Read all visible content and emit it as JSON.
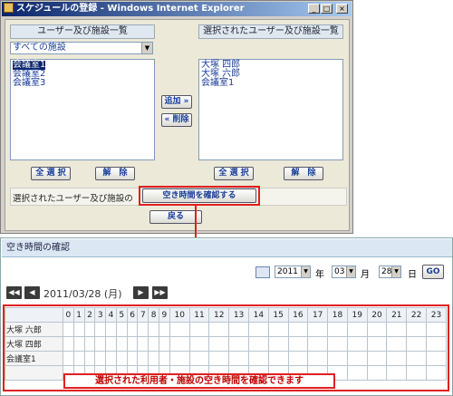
{
  "window": {
    "title": "スケジュールの登録 - Windows Internet Explorer",
    "minimize": "_",
    "maximize": "□",
    "close": "×"
  },
  "left_panel": {
    "header": "ユーザー及び施設一覧",
    "filter_value": "すべての施設",
    "items": [
      "会議室1",
      "会議室2",
      "会議室3"
    ],
    "select_all": "全 選 択",
    "deselect": "解　除"
  },
  "middle": {
    "add": "追加 »",
    "remove": "« 削除"
  },
  "right_panel": {
    "header": "選択されたユーザー及び施設一覧",
    "items": [
      "大塚 四郎",
      "大塚 六郎",
      "会議室1"
    ],
    "select_all": "全 選 択",
    "deselect": "解　除"
  },
  "footer": {
    "label": "選択されたユーザー及び施設の",
    "check_button": "空き時間を確認する",
    "back_button": "戻る"
  },
  "availability": {
    "header": "空き時間の確認",
    "year": "2011",
    "year_suffix": "年",
    "month": "03",
    "month_suffix": "月",
    "day": "28",
    "day_suffix": "日",
    "go": "GO",
    "nav_first": "◀◀",
    "nav_prev": "◀",
    "date_label": "2011/03/28 (月)",
    "nav_next": "▶",
    "nav_last": "▶▶",
    "hours": [
      "0",
      "1",
      "2",
      "3",
      "4",
      "5",
      "6",
      "7",
      "8",
      "9",
      "10",
      "11",
      "12",
      "13",
      "14",
      "15",
      "16",
      "17",
      "18",
      "19",
      "20",
      "21",
      "22",
      "23"
    ],
    "rows": [
      "大塚 六郎",
      "大塚 四郎",
      "会議室1"
    ]
  },
  "callout": {
    "text": "選択された利用者・施設の空き時間を確認できます"
  },
  "colors": {
    "titlebar": "#0a246a",
    "highlight_red": "#e02020",
    "link_blue": "#1a3d9a"
  }
}
